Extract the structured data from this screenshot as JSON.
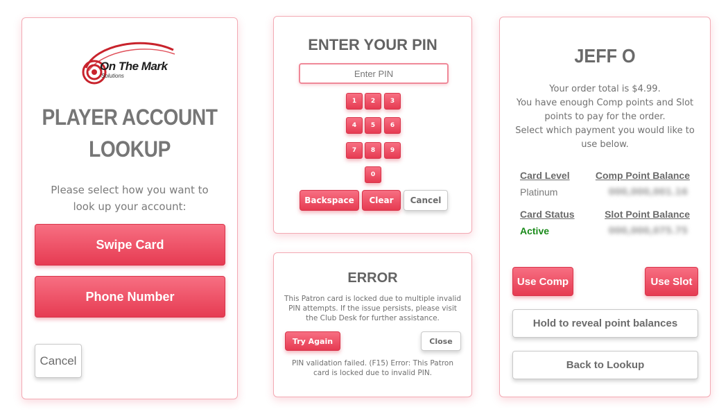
{
  "lookup": {
    "logo_text": "On The Mark",
    "logo_subtext": "Solutions",
    "title": "PLAYER ACCOUNT LOOKUP",
    "prompt": "Please select how you want to look up your account:",
    "swipe_label": "Swipe Card",
    "phone_label": "Phone Number",
    "cancel_label": "Cancel"
  },
  "pin": {
    "title": "ENTER YOUR PIN",
    "input_placeholder": "Enter PIN",
    "keys": [
      "1",
      "2",
      "3",
      "4",
      "5",
      "6",
      "7",
      "8",
      "9",
      "0"
    ],
    "backspace_label": "Backspace",
    "clear_label": "Clear",
    "cancel_label": "Cancel"
  },
  "error": {
    "title": "ERROR",
    "message": "This Patron card is locked due to multiple invalid PIN attempts. If the issue persists, please visit the Club Desk for further assistance.",
    "try_again_label": "Try Again",
    "close_label": "Close",
    "detail": "PIN validation failed. (F15) Error: This Patron card is locked due to invalid PIN."
  },
  "player": {
    "name": "JEFF O",
    "order_total": "Your order total is $4.99.",
    "enough_points": "You have enough Comp points and Slot points to pay for the order.",
    "select_payment": "Select which payment you would like to use below.",
    "card_level_label": "Card Level",
    "card_level_value": "Platinum",
    "comp_balance_label": "Comp Point Balance",
    "comp_balance_value": "000,000,001.16",
    "card_status_label": "Card Status",
    "card_status_value": "Active",
    "slot_balance_label": "Slot Point Balance",
    "slot_balance_value": "000,000,075.75",
    "use_comp_label": "Use Comp",
    "use_slot_label": "Use Slot",
    "hold_label": "Hold to reveal point balances",
    "back_label": "Back to Lookup"
  },
  "colors": {
    "accent": "#e8465c",
    "accent_light": "#f76f82",
    "status_active": "#1a8a1a",
    "card_border": "#f3a9b3"
  }
}
